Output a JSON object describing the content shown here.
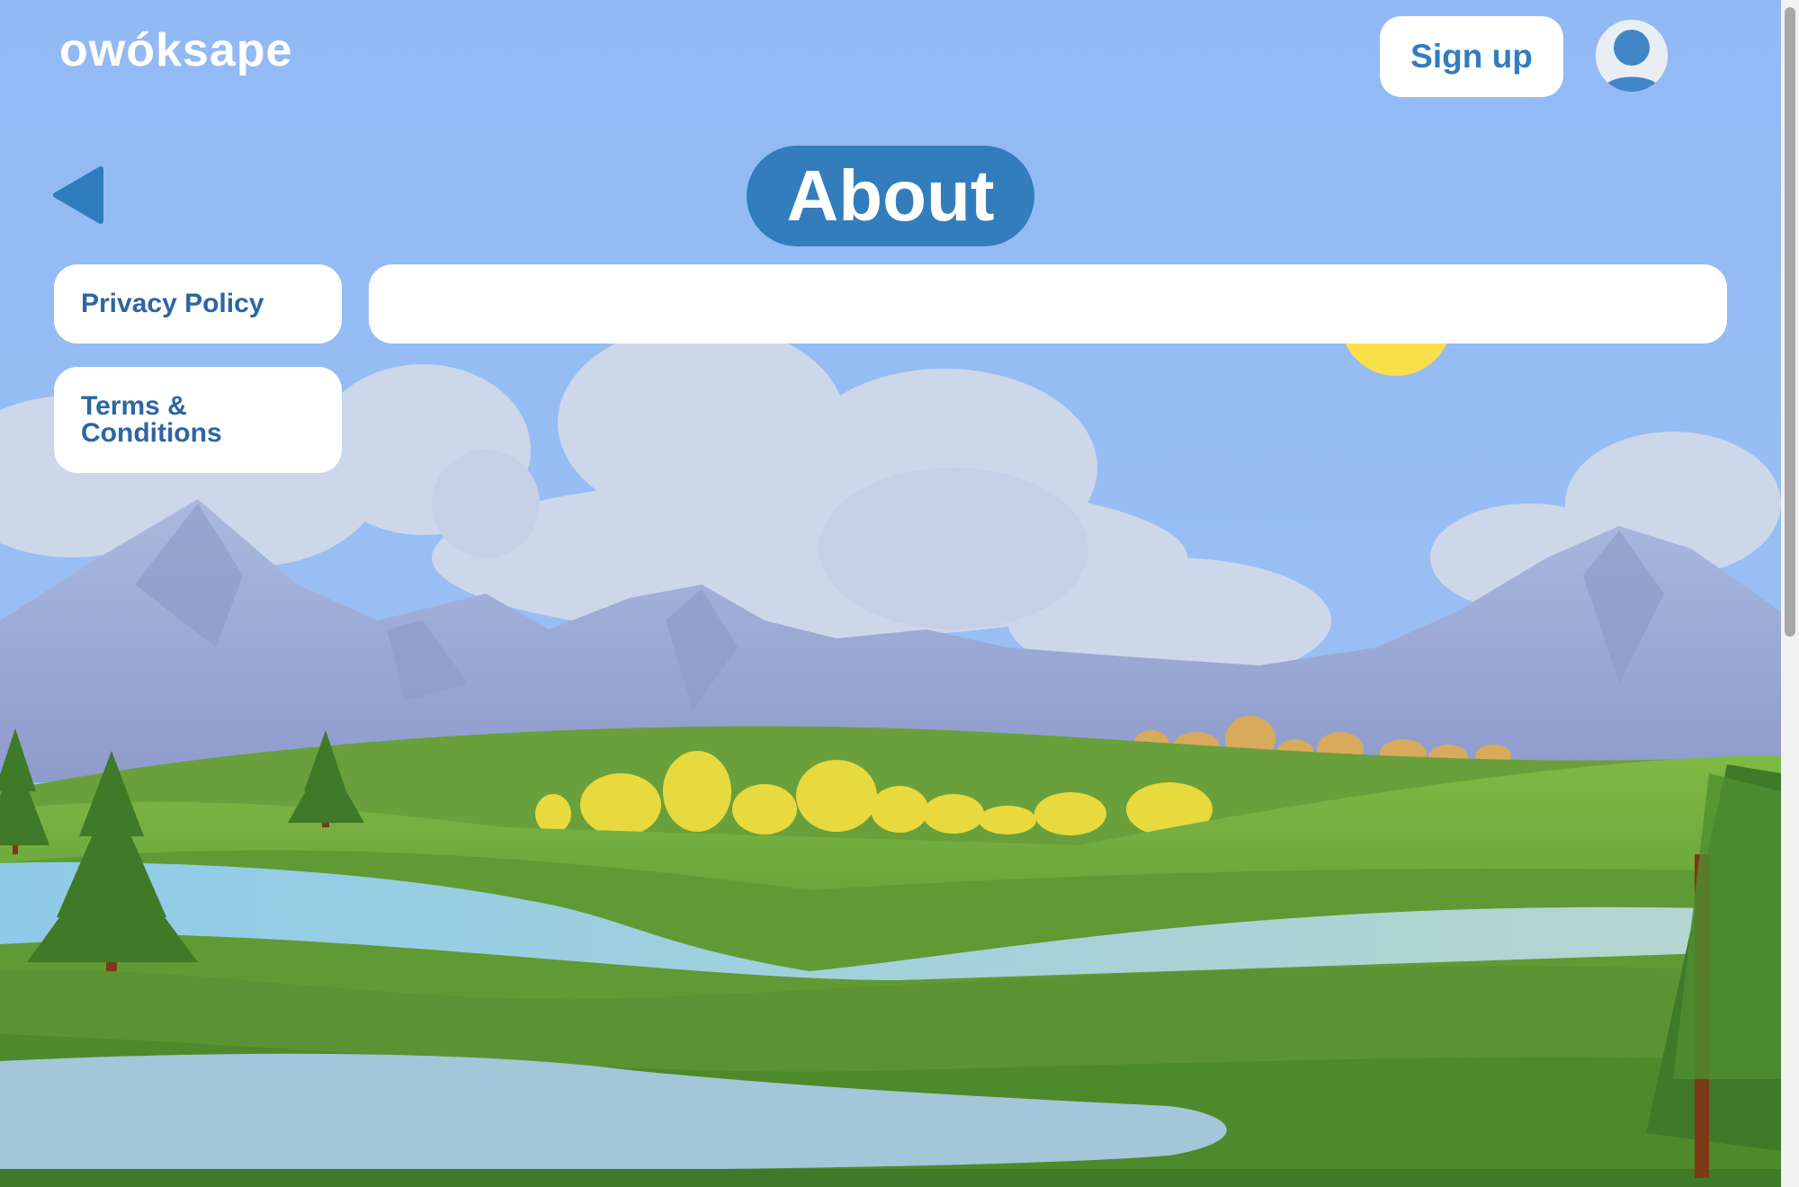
{
  "header": {
    "logo_text": "owóksape",
    "signup_label": "Sign up",
    "avatar_icon": "user-avatar-icon"
  },
  "page": {
    "title": "About",
    "back_icon": "back-arrow-icon"
  },
  "sidebar": {
    "items": [
      {
        "label": "Privacy Policy"
      },
      {
        "label": "Terms & Conditions"
      }
    ]
  },
  "content": {
    "text": ""
  },
  "colors": {
    "sky": "#92b9f4",
    "accent": "#337dbd",
    "link_text": "#2c66a3",
    "panel": "#ffffff",
    "sun": "#f9e04b",
    "grass": "#5e9c36",
    "water": "#8ecbe6"
  }
}
